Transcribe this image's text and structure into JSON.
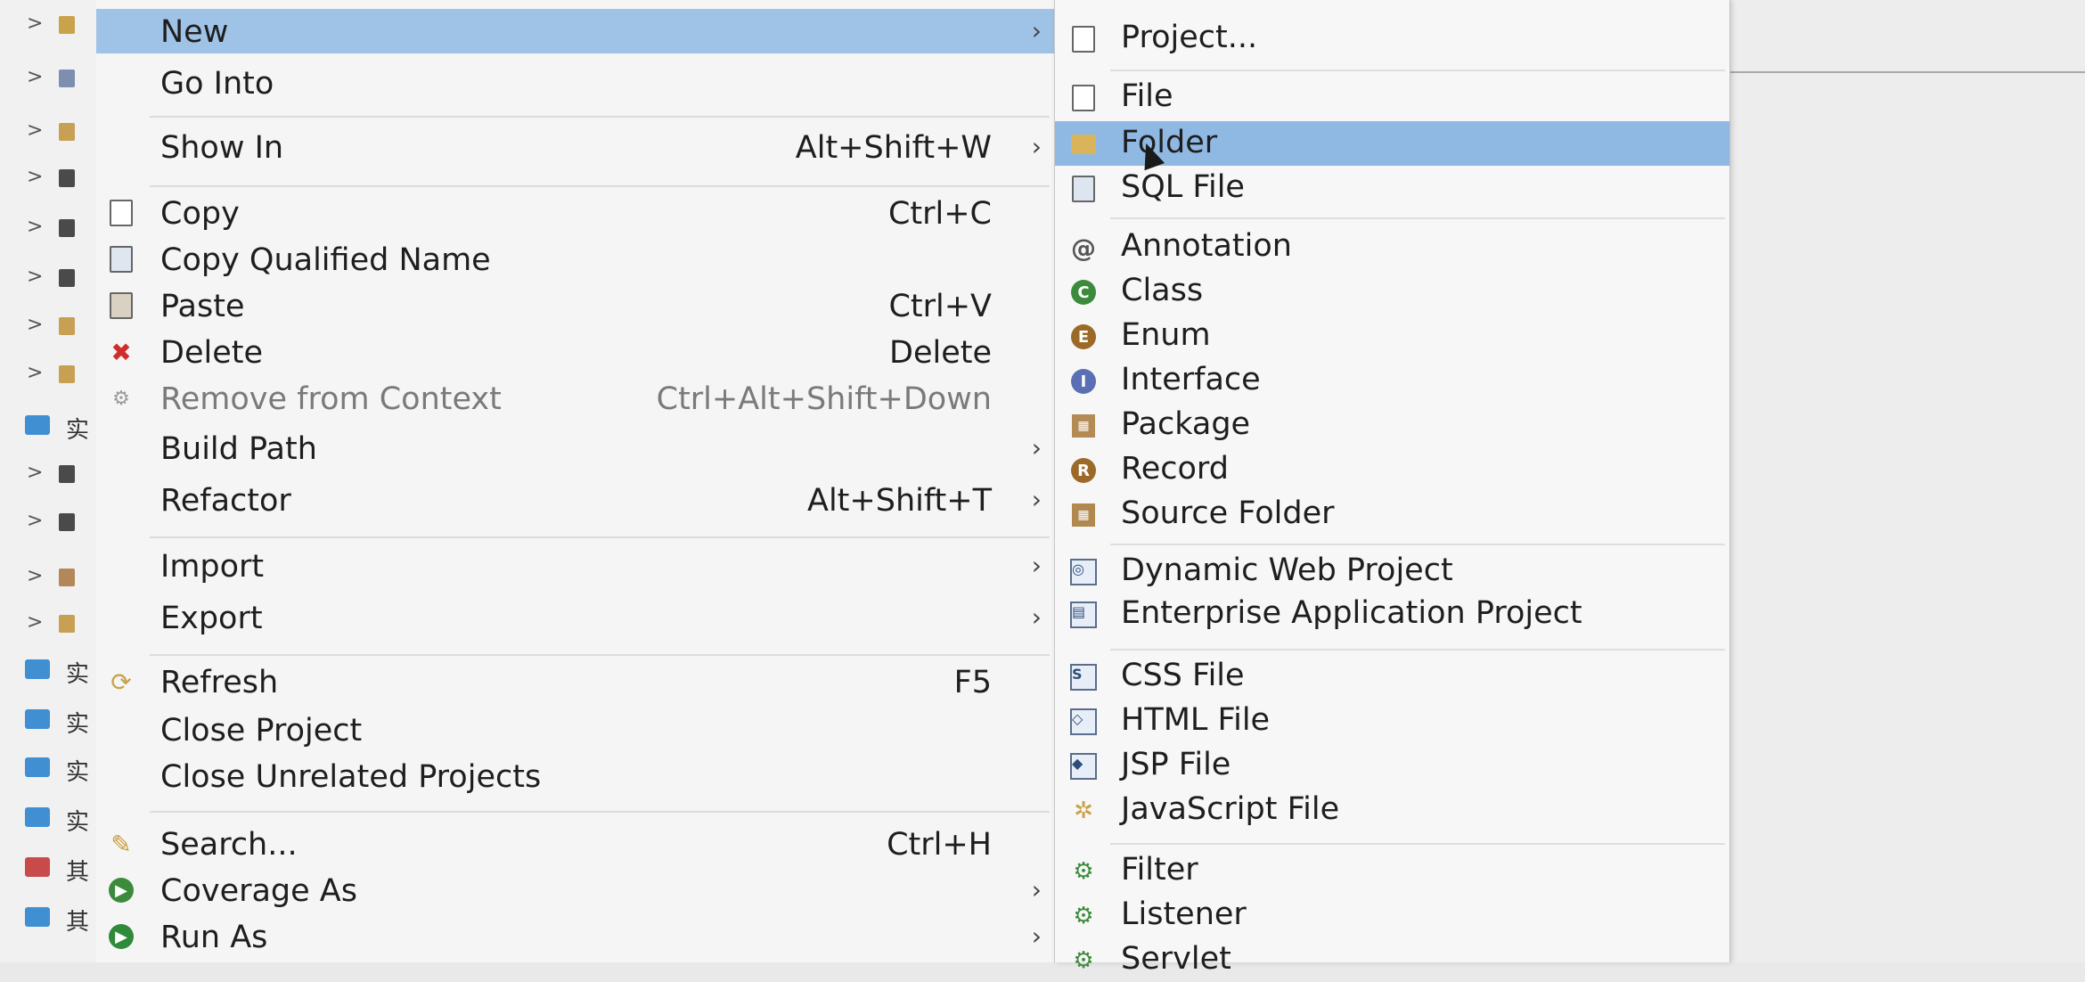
{
  "context_menu": {
    "items": [
      {
        "label": "New",
        "shortcut": "",
        "submenu": true
      },
      {
        "label": "Go Into",
        "shortcut": "",
        "submenu": false
      },
      {
        "label": "Show In",
        "shortcut": "Alt+Shift+W",
        "submenu": true
      },
      {
        "label": "Copy",
        "shortcut": "Ctrl+C",
        "submenu": false
      },
      {
        "label": "Copy Qualified Name",
        "shortcut": "",
        "submenu": false
      },
      {
        "label": "Paste",
        "shortcut": "Ctrl+V",
        "submenu": false
      },
      {
        "label": "Delete",
        "shortcut": "Delete",
        "submenu": false
      },
      {
        "label": "Remove from Context",
        "shortcut": "Ctrl+Alt+Shift+Down",
        "submenu": false
      },
      {
        "label": "Build Path",
        "shortcut": "",
        "submenu": true
      },
      {
        "label": "Refactor",
        "shortcut": "Alt+Shift+T",
        "submenu": true
      },
      {
        "label": "Import",
        "shortcut": "",
        "submenu": true
      },
      {
        "label": "Export",
        "shortcut": "",
        "submenu": true
      },
      {
        "label": "Refresh",
        "shortcut": "F5",
        "submenu": false
      },
      {
        "label": "Close Project",
        "shortcut": "",
        "submenu": false
      },
      {
        "label": "Close Unrelated Projects",
        "shortcut": "",
        "submenu": false
      },
      {
        "label": "Search...",
        "shortcut": "Ctrl+H",
        "submenu": false
      },
      {
        "label": "Coverage As",
        "shortcut": "",
        "submenu": true
      },
      {
        "label": "Run As",
        "shortcut": "",
        "submenu": true
      }
    ]
  },
  "new_submenu": {
    "items": [
      {
        "label": "Project..."
      },
      {
        "label": "File"
      },
      {
        "label": "Folder"
      },
      {
        "label": "SQL File"
      },
      {
        "label": "Annotation"
      },
      {
        "label": "Class"
      },
      {
        "label": "Enum"
      },
      {
        "label": "Interface"
      },
      {
        "label": "Package"
      },
      {
        "label": "Record"
      },
      {
        "label": "Source Folder"
      },
      {
        "label": "Dynamic Web Project"
      },
      {
        "label": "Enterprise Application Project"
      },
      {
        "label": "CSS File"
      },
      {
        "label": "HTML File"
      },
      {
        "label": "JSP File"
      },
      {
        "label": "JavaScript File"
      },
      {
        "label": "Filter"
      },
      {
        "label": "Listener"
      },
      {
        "label": "Servlet"
      }
    ]
  },
  "explorer": {
    "glyphs": [
      "实",
      "实",
      "实",
      "实",
      "实",
      "其",
      "其"
    ]
  },
  "icons": {
    "copy": "copy-icon",
    "copy_qualified": "copy-qualified-name-icon",
    "paste": "paste-icon",
    "delete": "delete-icon",
    "remove_context": "remove-context-icon",
    "refresh": "refresh-icon",
    "search": "search-icon",
    "coverage": "coverage-icon",
    "run": "run-icon"
  },
  "colors": {
    "menu_bg": "#f5f5f5",
    "highlight": "#9fc3e6",
    "sub_highlight": "#8fb9e3",
    "delete_red": "#d22b2b",
    "class_green": "#3c8b3c",
    "enum_brown": "#9c6a28",
    "interface_blue": "#5a6fb4"
  }
}
